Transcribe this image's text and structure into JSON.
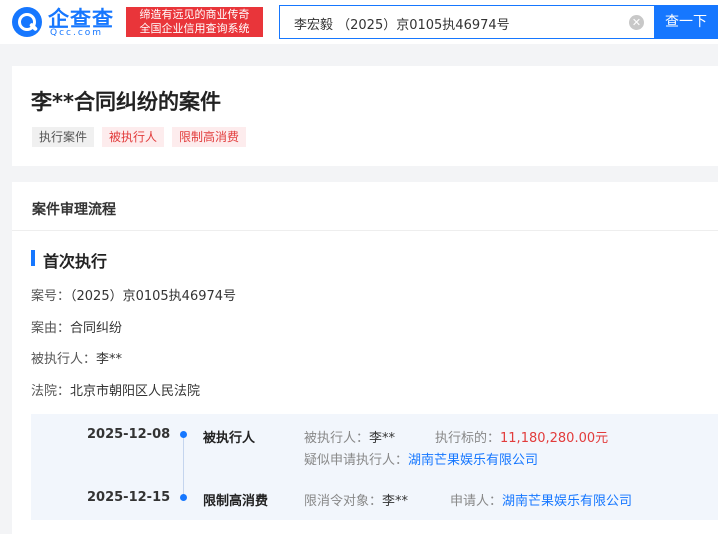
{
  "header": {
    "logo_name": "企查查",
    "logo_domain": "Qcc.com",
    "slogan_line1": "缔造有远见的商业传奇",
    "slogan_line2": "全国企业信用查询系统",
    "search_value": "李宏毅 （2025）京0105执46974号",
    "search_button": "查一下"
  },
  "case": {
    "title": "李**合同纠纷的案件",
    "tags": [
      {
        "label": "执行案件",
        "style": "gray"
      },
      {
        "label": "被执行人",
        "style": "red"
      },
      {
        "label": "限制高消费",
        "style": "red"
      }
    ]
  },
  "process": {
    "header": "案件审理流程",
    "stage_title": "首次执行",
    "info": [
      {
        "label": "案号：",
        "value": "（2025）京0105执46974号"
      },
      {
        "label": "案由：",
        "value": "合同纠纷"
      },
      {
        "label": "被执行人：",
        "value": "李**"
      },
      {
        "label": "法院：",
        "value": "北京市朝阳区人民法院"
      }
    ],
    "timeline": [
      {
        "date": "2025-12-08",
        "kind": "被执行人",
        "f1_label": "被执行人：",
        "f1_value": "李**",
        "f2_label": "执行标的：",
        "f2_value": "11,180,280.00元",
        "f3_label": "疑似申请执行人：",
        "f3_value": "湖南芒果娱乐有限公司"
      },
      {
        "date": "2025-12-15",
        "kind": "限制高消费",
        "f1_label": "限消令对象：",
        "f1_value": "李**",
        "f2_label": "申请人：",
        "f2_value": "湖南芒果娱乐有限公司"
      }
    ]
  },
  "colors": {
    "brand_blue": "#1677ff",
    "slogan_red": "#e9353a",
    "tag_red": "#e23c3c",
    "amount_red": "#e23c3c"
  },
  "icons": {
    "logo": "qcc-logo-icon",
    "clear": "clear-icon",
    "timeline_dot": "timeline-dot-icon"
  }
}
